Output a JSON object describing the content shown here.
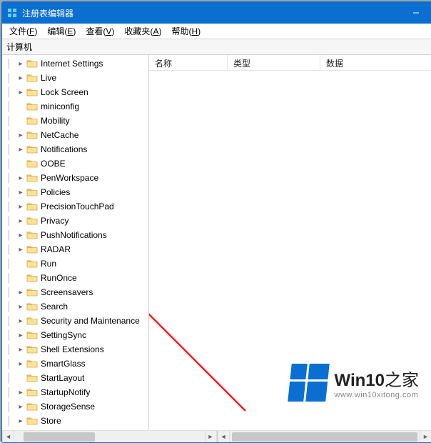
{
  "window": {
    "title": "注册表编辑器"
  },
  "menu": {
    "file": {
      "label": "文件",
      "accel": "F"
    },
    "edit": {
      "label": "编辑",
      "accel": "E"
    },
    "view": {
      "label": "查看",
      "accel": "V"
    },
    "fav": {
      "label": "收藏夹",
      "accel": "A"
    },
    "help": {
      "label": "帮助",
      "accel": "H"
    }
  },
  "address": {
    "path": "计算机"
  },
  "columns": {
    "name": "名称",
    "type": "类型",
    "data": "数据"
  },
  "tree": {
    "items": [
      {
        "label": "Internet Settings",
        "expand": "closed"
      },
      {
        "label": "Live",
        "expand": "closed"
      },
      {
        "label": "Lock Screen",
        "expand": "closed"
      },
      {
        "label": "miniconfig",
        "expand": "none"
      },
      {
        "label": "Mobility",
        "expand": "none"
      },
      {
        "label": "NetCache",
        "expand": "closed"
      },
      {
        "label": "Notifications",
        "expand": "closed"
      },
      {
        "label": "OOBE",
        "expand": "none"
      },
      {
        "label": "PenWorkspace",
        "expand": "closed"
      },
      {
        "label": "Policies",
        "expand": "closed"
      },
      {
        "label": "PrecisionTouchPad",
        "expand": "closed"
      },
      {
        "label": "Privacy",
        "expand": "closed"
      },
      {
        "label": "PushNotifications",
        "expand": "closed"
      },
      {
        "label": "RADAR",
        "expand": "closed"
      },
      {
        "label": "Run",
        "expand": "none"
      },
      {
        "label": "RunOnce",
        "expand": "none"
      },
      {
        "label": "Screensavers",
        "expand": "closed"
      },
      {
        "label": "Search",
        "expand": "closed"
      },
      {
        "label": "Security and Maintenance",
        "expand": "closed"
      },
      {
        "label": "SettingSync",
        "expand": "closed"
      },
      {
        "label": "Shell Extensions",
        "expand": "closed"
      },
      {
        "label": "SmartGlass",
        "expand": "closed"
      },
      {
        "label": "StartLayout",
        "expand": "none"
      },
      {
        "label": "StartupNotify",
        "expand": "closed"
      },
      {
        "label": "StorageSense",
        "expand": "closed"
      },
      {
        "label": "Store",
        "expand": "closed"
      }
    ]
  },
  "watermark": {
    "brand_a": "Win10",
    "brand_b": "之家",
    "url": "www.win10xitong.com"
  }
}
